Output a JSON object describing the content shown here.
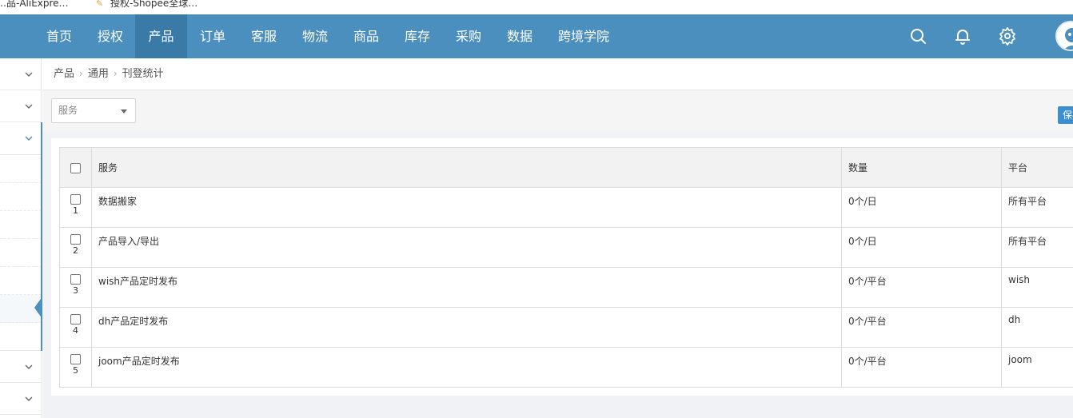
{
  "bookmarks": [
    {
      "label": "…品-AliExpre…"
    },
    {
      "label": "授权-Shopee全球…"
    }
  ],
  "nav": {
    "items": [
      {
        "label": "首页"
      },
      {
        "label": "授权"
      },
      {
        "label": "产品",
        "active": true
      },
      {
        "label": "订单"
      },
      {
        "label": "客服"
      },
      {
        "label": "物流"
      },
      {
        "label": "商品"
      },
      {
        "label": "库存"
      },
      {
        "label": "采购"
      },
      {
        "label": "数据"
      },
      {
        "label": "跨境学院"
      }
    ],
    "icons": [
      "search-icon",
      "bell-icon",
      "gear-icon",
      "avatar"
    ]
  },
  "breadcrumb": {
    "items": [
      "产品",
      "通用",
      "刊登统计"
    ]
  },
  "filter": {
    "service_select": {
      "value": "服务"
    },
    "save_label": "保存"
  },
  "table": {
    "headers": {
      "service": "服务",
      "count": "数量",
      "platform": "平台"
    },
    "rows": [
      {
        "num": "1",
        "service": "数据搬家",
        "count": "0个/日",
        "platform": "所有平台"
      },
      {
        "num": "2",
        "service": "产品导入/导出",
        "count": "0个/日",
        "platform": "所有平台"
      },
      {
        "num": "3",
        "service": "wish产品定时发布",
        "count": "0个/平台",
        "platform": "wish"
      },
      {
        "num": "4",
        "service": "dh产品定时发布",
        "count": "0个/平台",
        "platform": "dh"
      },
      {
        "num": "5",
        "service": "joom产品定时发布",
        "count": "0个/平台",
        "platform": "joom"
      }
    ]
  },
  "colors": {
    "nav_bg": "#4a8fbe",
    "nav_active": "#3a7aa6",
    "accent": "#3b8fd1"
  }
}
